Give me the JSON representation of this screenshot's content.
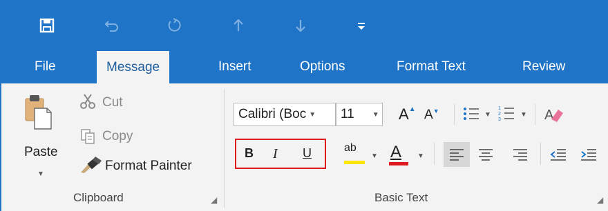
{
  "quick_access": {
    "icons": [
      "save-icon",
      "undo-icon",
      "redo-icon",
      "previous-item-icon",
      "next-item-icon",
      "customize-qat-icon"
    ]
  },
  "tabs": [
    {
      "label": "File",
      "active": false
    },
    {
      "label": "Message",
      "active": true
    },
    {
      "label": "Insert",
      "active": false
    },
    {
      "label": "Options",
      "active": false
    },
    {
      "label": "Format Text",
      "active": false
    },
    {
      "label": "Review",
      "active": false
    }
  ],
  "clipboard": {
    "paste_label": "Paste",
    "cut_label": "Cut",
    "copy_label": "Copy",
    "format_painter_label": "Format Painter",
    "group_label": "Clipboard"
  },
  "basic_text": {
    "font_name": "Calibri (Boc",
    "font_size": "11",
    "grow_font_label": "A",
    "shrink_font_label": "A",
    "bold_label": "B",
    "italic_label": "I",
    "underline_label": "U",
    "highlight_label": "ab",
    "font_color_label": "A",
    "group_label": "Basic Text"
  },
  "colors": {
    "accent": "#1f74c7",
    "ribbon": "#f3f3f3",
    "highlight_box": "#e0191f",
    "highlight_yellow": "#ffe500",
    "font_color_red": "#e0191f"
  }
}
